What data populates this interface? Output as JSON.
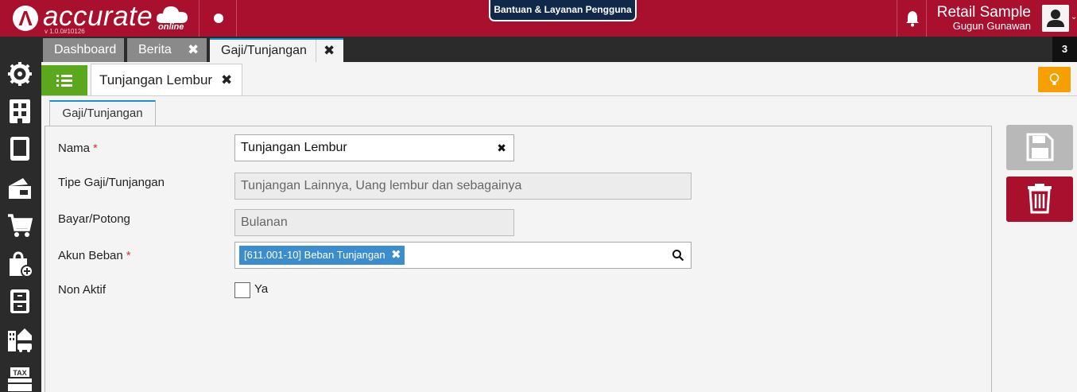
{
  "app": {
    "brand": "accurate",
    "brand_sub": "online",
    "version": "v 1.0.0#10126",
    "help_label": "Bantuan & Layanan Pengguna",
    "company": "Retail Sample",
    "user": "Gugun Gunawan"
  },
  "tabs": [
    {
      "label": "Dashboard",
      "closable": false
    },
    {
      "label": "Berita",
      "closable": true
    },
    {
      "label": "Gaji/Tunjangan",
      "closable": true,
      "active": true
    }
  ],
  "tab_count": "3",
  "subtab": {
    "label": "Tunjangan Lembur"
  },
  "form_tab": "Gaji/Tunjangan",
  "form": {
    "nama": {
      "label": "Nama",
      "value": "Tunjangan Lembur"
    },
    "tipe": {
      "label": "Tipe Gaji/Tunjangan",
      "value": "Tunjangan Lainnya, Uang lembur dan sebagainya"
    },
    "bayar": {
      "label": "Bayar/Potong",
      "value": "Bulanan"
    },
    "akun": {
      "label": "Akun Beban",
      "chip": "[611.001-10] Beban Tunjangan"
    },
    "nonaktif": {
      "label": "Non Aktif",
      "option": "Ya",
      "checked": false
    }
  },
  "colors": {
    "brand": "#a8102e",
    "accent_blue": "#1e90d0",
    "green": "#5ba81e",
    "orange": "#f5a000"
  },
  "icons": [
    "settings-icon",
    "building-icon",
    "book-icon",
    "money-icon",
    "cart-icon",
    "shopping-bag-icon",
    "cabinet-icon",
    "assets-icon",
    "tax-icon"
  ]
}
